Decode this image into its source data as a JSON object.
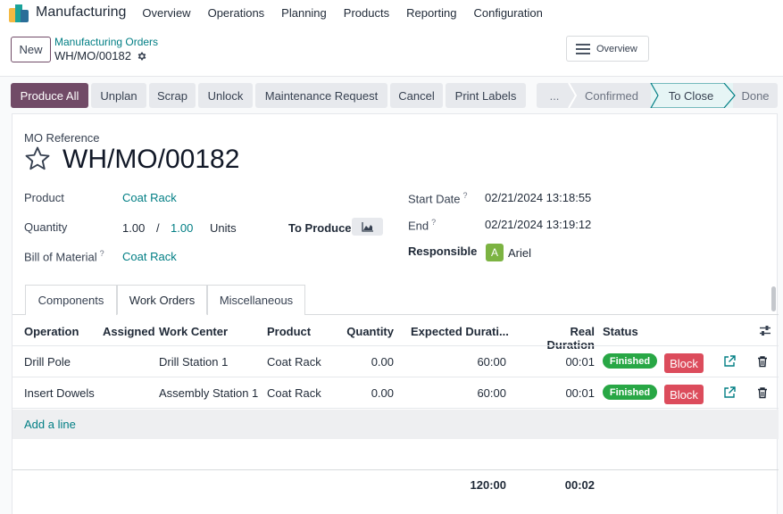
{
  "navbar": {
    "app_name": "Manufacturing",
    "menu": [
      "Overview",
      "Operations",
      "Planning",
      "Products",
      "Reporting",
      "Configuration"
    ]
  },
  "control_panel": {
    "new_label": "New",
    "breadcrumb": "Manufacturing Orders",
    "record_name": "WH/MO/00182",
    "overview_label": "Overview"
  },
  "actions": {
    "produce_all": "Produce All",
    "unplan": "Unplan",
    "scrap": "Scrap",
    "unlock": "Unlock",
    "maintenance_request": "Maintenance Request",
    "cancel": "Cancel",
    "print_labels": "Print Labels"
  },
  "statusbar": {
    "more": "...",
    "stages": [
      "Confirmed",
      "To Close",
      "Done"
    ],
    "active": "To Close"
  },
  "form": {
    "reference_label": "MO Reference",
    "reference": "WH/MO/00182",
    "product_label": "Product",
    "product": "Coat Rack",
    "quantity_label": "Quantity",
    "quantity_done": "1.00",
    "quantity_separator": "/",
    "quantity_total": "1.00",
    "uom": "Units",
    "to_produce_label": "To Produce",
    "bom_label": "Bill of Material",
    "bom_help": "?",
    "bom": "Coat Rack",
    "start_date_label": "Start Date",
    "start_date_help": "?",
    "start_date": "02/21/2024 13:18:55",
    "end_label": "End",
    "end_help": "?",
    "end": "02/21/2024 13:19:12",
    "responsible_label": "Responsible",
    "responsible_initial": "A",
    "responsible": "Ariel"
  },
  "tabs": [
    "Components",
    "Work Orders",
    "Miscellaneous"
  ],
  "active_tab": "Work Orders",
  "work_orders": {
    "columns": [
      "Operation",
      "Assigned",
      "Work Center",
      "Product",
      "Quantity",
      "Expected Durati...",
      "Real Duration",
      "Status"
    ],
    "rows": [
      {
        "operation": "Drill Pole",
        "assigned": "",
        "work_center": "Drill Station 1",
        "product": "Coat Rack",
        "quantity": "0.00",
        "expected": "60:00",
        "real": "00:01",
        "status": "Finished",
        "block": "Block"
      },
      {
        "operation": "Insert Dowels",
        "assigned": "",
        "work_center": "Assembly Station 1",
        "product": "Coat Rack",
        "quantity": "0.00",
        "expected": "60:00",
        "real": "00:01",
        "status": "Finished",
        "block": "Block"
      }
    ],
    "add_line": "Add a line",
    "total_expected": "120:00",
    "total_real": "00:02"
  },
  "icons": {
    "gear": "gear-icon",
    "star": "star-icon",
    "forecast": "area-chart-icon",
    "optional_columns": "sliders-icon",
    "open": "external-link-icon",
    "delete": "trash-icon"
  },
  "colors": {
    "primary": "#714b67",
    "link": "#017e84",
    "success": "#28a745",
    "danger": "#dc4c5c"
  }
}
